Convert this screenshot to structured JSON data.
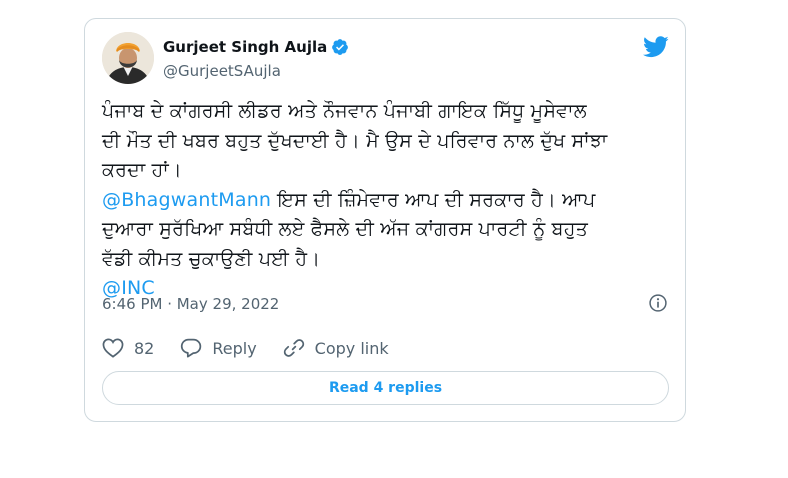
{
  "tweet": {
    "author_name": "Gurjeet Singh Aujla",
    "author_handle": "@GurjeetSAujla",
    "avatar_icon": "profile-photo",
    "verified_icon": "verified-badge-icon",
    "platform_icon": "twitter-bird-icon",
    "text_lines": [
      "ਪੰਜਾਬ  ਦੇ ਕਾਂਗਰਸੀ ਲੀਡਰ ਅਤੇ ਨੌਜਵਾਨ ਪੰਜਾਬੀ ਗਾਇਕ ਸਿੱਧੂ ਮੂਸੇਵਾਲ",
      "ਦੀ ਮੌਤ ਦੀ ਖਬਰ ਬਹੁਤ ਦੁੱਖਦਾਈ ਹੈ। ਮੈ ਉਸ ਦੇ ਪਰਿਵਾਰ ਨਾਲ ਦੁੱਖ ਸਾਂਝਾ",
      "ਕਰਦਾ ਹਾਂ।"
    ],
    "mention_1": "@BhagwantMann",
    "text_after_mention_1": " ਇਸ ਦੀ ਜ਼ਿੰਮੇਵਾਰ ਆਪ ਦੀ ਸਰਕਾਰ ਹੈ। ਆਪ",
    "text_lines_2": [
      "ਦੁਆਰਾ ਸੁਰੱਖਿਆ ਸਬੰਧੀ ਲਏ ਫੈਸਲੇ ਦੀ ਅੱਜ ਕਾਂਗਰਸ ਪਾਰਟੀ ਨੂੰ ਬਹੁਤ",
      "ਵੱਡੀ ਕੀਮਤ ਚੁਕਾਉਣੀ ਪਈ ਹੈ।"
    ],
    "mention_2": "@INC",
    "timestamp": "6:46 PM · May 29, 2022",
    "info_icon": "info-icon",
    "like_count": "82",
    "reply_label": "Reply",
    "copy_link_label": "Copy link",
    "read_replies_label": "Read 4 replies"
  },
  "colors": {
    "accent": "#1d9bf0",
    "text": "#0f1419",
    "secondary": "#536471",
    "border": "#cfd9de"
  }
}
